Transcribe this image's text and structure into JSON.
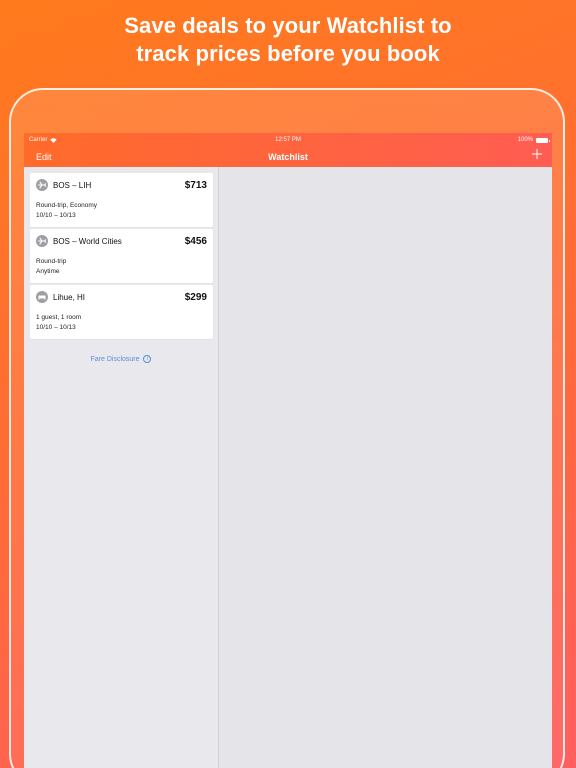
{
  "headline": {
    "line1": "Save deals to your Watchlist to",
    "line2": "track prices before you book"
  },
  "statusbar": {
    "carrier": "Carrier",
    "time": "12:57 PM",
    "battery": "100%"
  },
  "navbar": {
    "edit_label": "Edit",
    "title": "Watchlist",
    "add_icon": "plus-icon"
  },
  "watchlist": [
    {
      "icon": "flight-icon",
      "title": "BOS – LIH",
      "price": "$713",
      "line1": "Round-trip, Economy",
      "line2": "10/10 – 10/13"
    },
    {
      "icon": "flight-icon",
      "title": "BOS – World Cities",
      "price": "$456",
      "line1": "Round-trip",
      "line2": "Anytime"
    },
    {
      "icon": "hotel-icon",
      "title": "Lihue, HI",
      "price": "$299",
      "line1": "1 guest, 1 room",
      "line2": "10/10 – 10/13"
    }
  ],
  "footer": {
    "fare_disclosure": "Fare Disclosure",
    "info_glyph": "i"
  },
  "colors": {
    "accent_orange": "#ff6b2a",
    "accent_red": "#ff5d52",
    "link_blue": "#5a8fd8",
    "icon_gray": "#9e9ea6"
  }
}
